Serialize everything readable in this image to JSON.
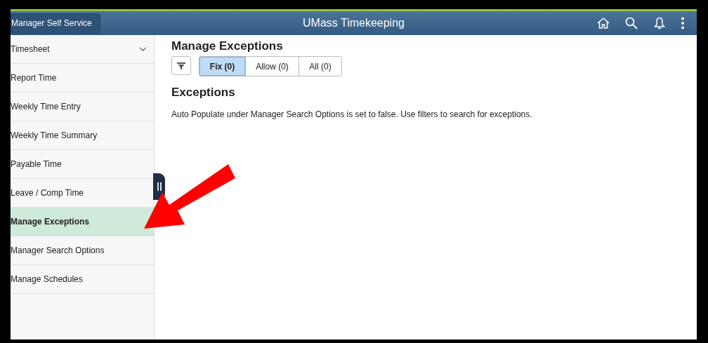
{
  "header": {
    "back_button": "Manager Self Service",
    "title": "UMass Timekeeping"
  },
  "sidebar": {
    "items": [
      {
        "label": "Timesheet",
        "kind": "group",
        "expanded": false,
        "selected": false
      },
      {
        "label": "Report Time",
        "kind": "link",
        "selected": false
      },
      {
        "label": "Weekly Time Entry",
        "kind": "link",
        "selected": false
      },
      {
        "label": "Weekly Time Summary",
        "kind": "link",
        "selected": false
      },
      {
        "label": "Payable Time",
        "kind": "link",
        "selected": false
      },
      {
        "label": "Leave / Comp Time",
        "kind": "link",
        "selected": false
      },
      {
        "label": "Manage Exceptions",
        "kind": "link",
        "selected": true
      },
      {
        "label": "Manager Search Options",
        "kind": "link",
        "selected": false
      },
      {
        "label": "Manage Schedules",
        "kind": "link",
        "selected": false
      }
    ]
  },
  "content": {
    "title": "Manage Exceptions",
    "segments": [
      {
        "label": "Fix (0)",
        "selected": true
      },
      {
        "label": "Allow (0)",
        "selected": false
      },
      {
        "label": "All (0)",
        "selected": false
      }
    ],
    "section_title": "Exceptions",
    "message": "Auto Populate under Manager Search Options is set to false. Use filters to search for exceptions."
  }
}
